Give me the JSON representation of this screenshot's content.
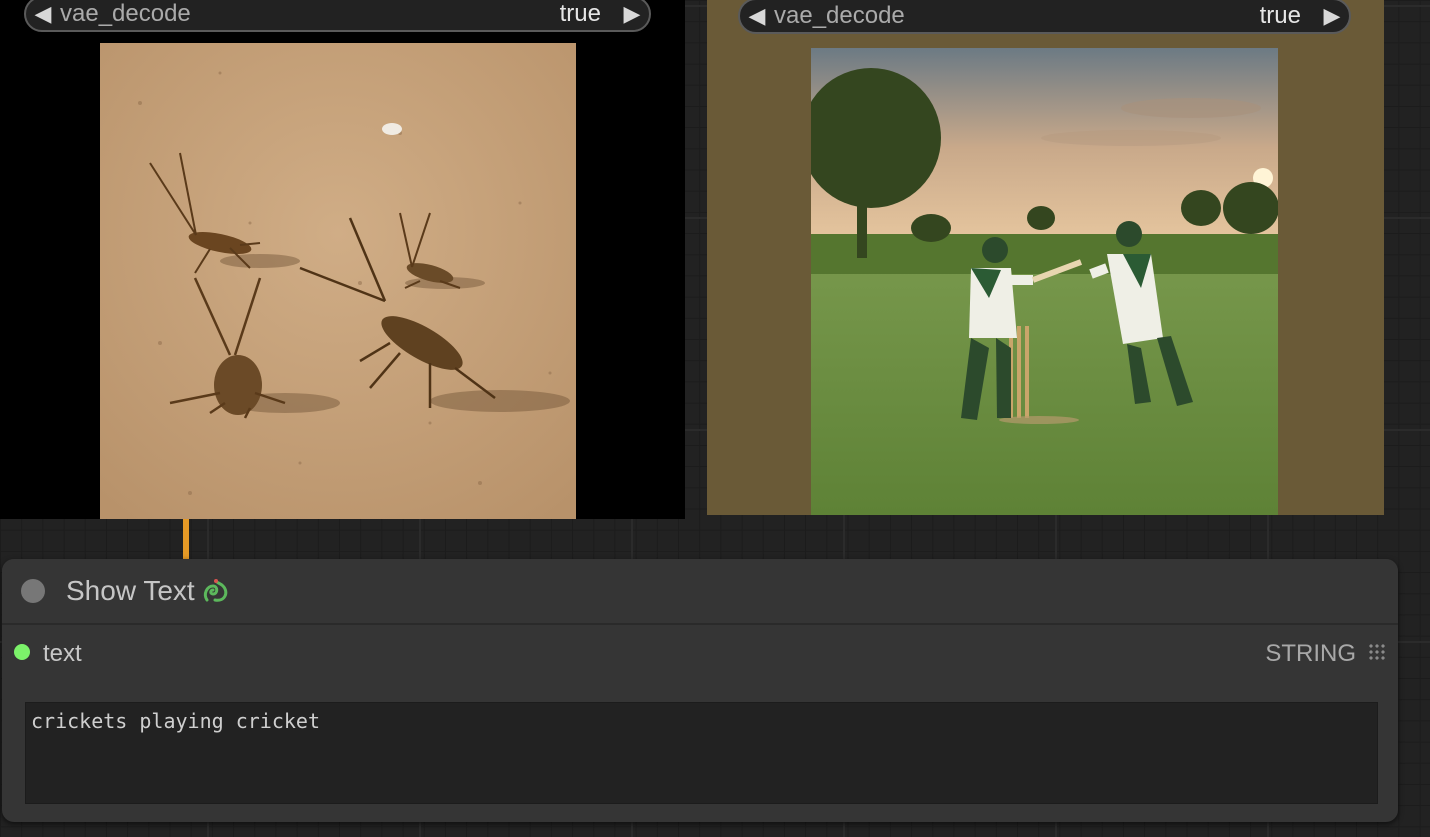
{
  "node_left": {
    "widget": {
      "name": "vae_decode",
      "value": "true",
      "prev_icon": "triangle-left-icon",
      "next_icon": "triangle-right-icon"
    },
    "preview_subject": "crickets on sand"
  },
  "node_right": {
    "widget": {
      "name": "vae_decode",
      "value": "true",
      "prev_icon": "triangle-left-icon",
      "next_icon": "triangle-right-icon"
    },
    "preview_subject": "cricket match"
  },
  "show_text_node": {
    "title": "Show Text",
    "title_icon": "snake-icon",
    "output": {
      "label": "text",
      "type": "STRING"
    },
    "textbox_value": "crickets playing cricket"
  },
  "colors": {
    "canvas": "#222222",
    "node_bg": "#353535",
    "link": "#e69a26",
    "string_slot": "#7cf26a",
    "right_node_bg": "#6a5a37"
  }
}
